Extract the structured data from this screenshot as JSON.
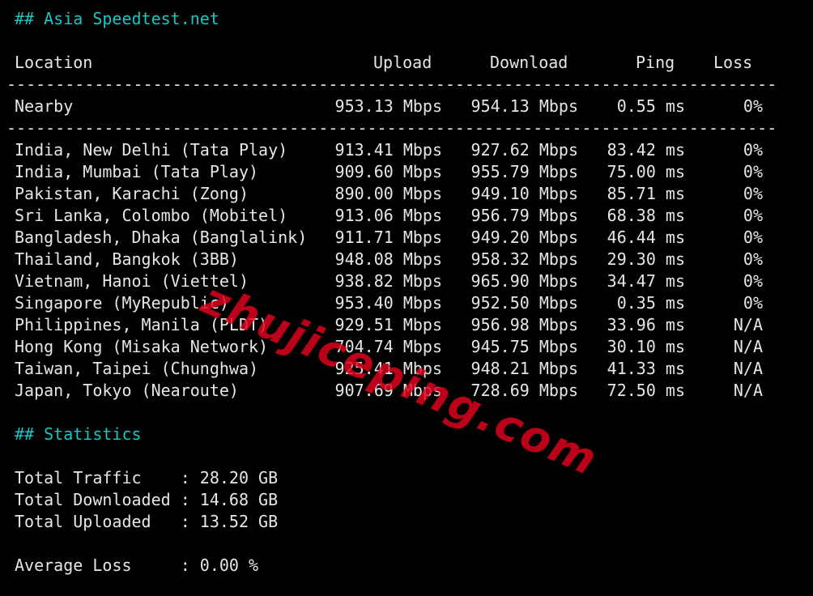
{
  "section_title": "## Asia Speedtest.net",
  "table": {
    "headers": {
      "location": "Location",
      "upload": "Upload",
      "download": "Download",
      "ping": "Ping",
      "loss": "Loss"
    },
    "separator": "-------------------------------------------------------------------------------",
    "nearby": {
      "location": "Nearby",
      "upload": "953.13 Mbps",
      "download": "954.13 Mbps",
      "ping": "0.55 ms",
      "loss": "0%"
    },
    "rows": [
      {
        "location": "India, New Delhi (Tata Play)",
        "upload": "913.41 Mbps",
        "download": "927.62 Mbps",
        "ping": "83.42 ms",
        "loss": "0%"
      },
      {
        "location": "India, Mumbai (Tata Play)",
        "upload": "909.60 Mbps",
        "download": "955.79 Mbps",
        "ping": "75.00 ms",
        "loss": "0%"
      },
      {
        "location": "Pakistan, Karachi (Zong)",
        "upload": "890.00 Mbps",
        "download": "949.10 Mbps",
        "ping": "85.71 ms",
        "loss": "0%"
      },
      {
        "location": "Sri Lanka, Colombo (Mobitel)",
        "upload": "913.06 Mbps",
        "download": "956.79 Mbps",
        "ping": "68.38 ms",
        "loss": "0%"
      },
      {
        "location": "Bangladesh, Dhaka (Banglalink)",
        "upload": "911.71 Mbps",
        "download": "949.20 Mbps",
        "ping": "46.44 ms",
        "loss": "0%"
      },
      {
        "location": "Thailand, Bangkok (3BB)",
        "upload": "948.08 Mbps",
        "download": "958.32 Mbps",
        "ping": "29.30 ms",
        "loss": "0%"
      },
      {
        "location": "Vietnam, Hanoi (Viettel)",
        "upload": "938.82 Mbps",
        "download": "965.90 Mbps",
        "ping": "34.47 ms",
        "loss": "0%"
      },
      {
        "location": "Singapore (MyRepublic)",
        "upload": "953.40 Mbps",
        "download": "952.50 Mbps",
        "ping": "0.35 ms",
        "loss": "0%"
      },
      {
        "location": "Philippines, Manila (PLDT)",
        "upload": "929.51 Mbps",
        "download": "956.98 Mbps",
        "ping": "33.96 ms",
        "loss": "N/A"
      },
      {
        "location": "Hong Kong (Misaka Network)",
        "upload": "704.74 Mbps",
        "download": "945.75 Mbps",
        "ping": "30.10 ms",
        "loss": "N/A"
      },
      {
        "location": "Taiwan, Taipei (Chunghwa)",
        "upload": "925.41 Mbps",
        "download": "948.21 Mbps",
        "ping": "41.33 ms",
        "loss": "N/A"
      },
      {
        "location": "Japan, Tokyo (Nearoute)",
        "upload": "907.69 Mbps",
        "download": "728.69 Mbps",
        "ping": "72.50 ms",
        "loss": "N/A"
      }
    ]
  },
  "statistics": {
    "title": "## Statistics",
    "items": [
      {
        "label": "Total Traffic    ",
        "value": "28.20 GB"
      },
      {
        "label": "Total Downloaded ",
        "value": "14.68 GB"
      },
      {
        "label": "Total Uploaded   ",
        "value": "13.52 GB"
      }
    ],
    "average_loss": {
      "label": "Average Loss     ",
      "value": "0.00 %"
    }
  },
  "watermark": "zhujiceping.com",
  "colors": {
    "background": "#000000",
    "text": "#e6e6e6",
    "heading": "#19c6c3",
    "watermark": "#e4001e"
  }
}
